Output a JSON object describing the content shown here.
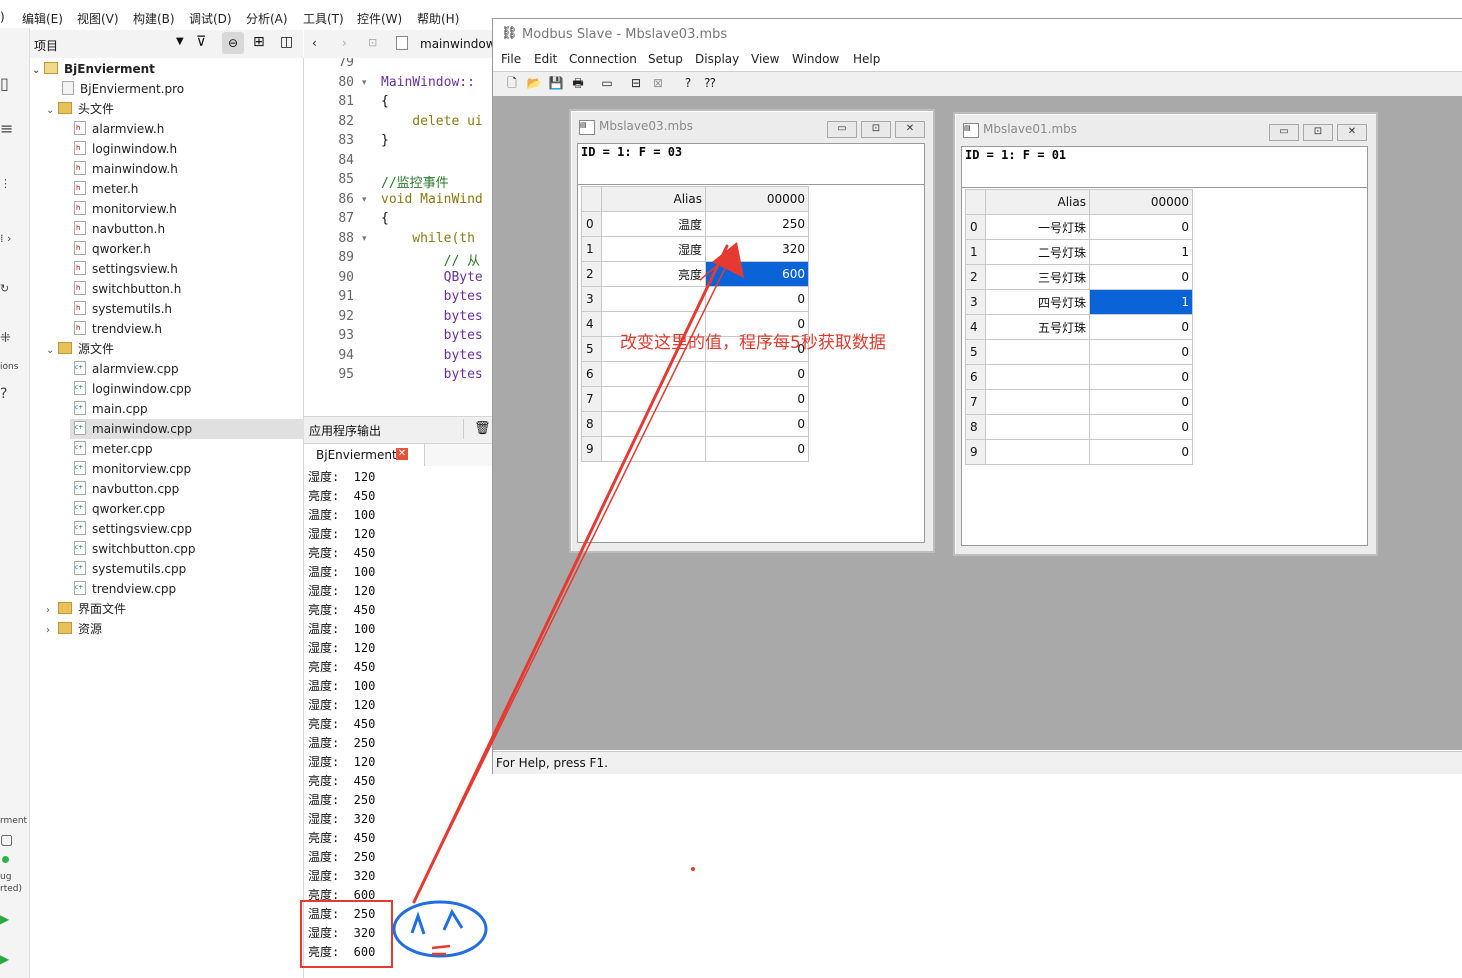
{
  "qt": {
    "menu": [
      "编辑(E)",
      "视图(V)",
      "构建(B)",
      "调试(D)",
      "分析(A)",
      "工具(T)",
      "控件(W)",
      "帮助(H)"
    ],
    "menu_prefix": ")",
    "project_panel_title": "项目",
    "mode_labels": [
      "ions",
      "rment",
      "ug",
      "rted)"
    ],
    "tree": {
      "project": "BjEnvierment",
      "pro_file": "BjEnvierment.pro",
      "headers_label": "头文件",
      "headers": [
        "alarmview.h",
        "loginwindow.h",
        "mainwindow.h",
        "meter.h",
        "monitorview.h",
        "navbutton.h",
        "qworker.h",
        "settingsview.h",
        "switchbutton.h",
        "systemutils.h",
        "trendview.h"
      ],
      "sources_label": "源文件",
      "sources": [
        "alarmview.cpp",
        "loginwindow.cpp",
        "main.cpp",
        "mainwindow.cpp",
        "meter.cpp",
        "monitorview.cpp",
        "navbutton.cpp",
        "qworker.cpp",
        "settingsview.cpp",
        "switchbutton.cpp",
        "systemutils.cpp",
        "trendview.cpp"
      ],
      "selected_source": "mainwindow.cpp",
      "forms_label": "界面文件",
      "resources_label": "资源"
    },
    "editor": {
      "tab_label": "mainwindow",
      "line_numbers": [
        "79",
        "80",
        "81",
        "82",
        "83",
        "84",
        "85",
        "86",
        "87",
        "88",
        "89",
        "90",
        "91",
        "92",
        "93",
        "94",
        "95"
      ],
      "lines": [
        "",
        "MainWindow::",
        "{",
        "    delete ui",
        "}",
        "",
        "//监控事件",
        "void MainWind",
        "{",
        "    while(th",
        "        // 从",
        "        QByte",
        "        bytes",
        "        bytes",
        "        bytes",
        "        bytes",
        "        bytes"
      ]
    },
    "output": {
      "header": "应用程序输出",
      "tab": "BjEnvierment",
      "lines": [
        "湿度:  120",
        "亮度:  450",
        "温度:  100",
        "湿度:  120",
        "亮度:  450",
        "温度:  100",
        "湿度:  120",
        "亮度:  450",
        "温度:  100",
        "湿度:  120",
        "亮度:  450",
        "温度:  100",
        "湿度:  120",
        "亮度:  450",
        "温度:  250",
        "湿度:  120",
        "亮度:  450",
        "温度:  250",
        "湿度:  320",
        "亮度:  450",
        "温度:  250",
        "湿度:  320",
        "亮度:  600",
        "温度:  250",
        "湿度:  320",
        "亮度:  600"
      ]
    }
  },
  "modbus": {
    "title": "Modbus Slave - Mbslave03.mbs",
    "menu": [
      "File",
      "Edit",
      "Connection",
      "Setup",
      "Display",
      "View",
      "Window",
      "Help"
    ],
    "status": "For Help, press F1.",
    "child1": {
      "title": "Mbslave03.mbs",
      "info": "ID = 1: F = 03",
      "col_alias": "Alias",
      "col_addr": "00000",
      "rows": [
        {
          "idx": "0",
          "alias": "温度",
          "value": "250"
        },
        {
          "idx": "1",
          "alias": "湿度",
          "value": "320"
        },
        {
          "idx": "2",
          "alias": "亮度",
          "value": "600"
        },
        {
          "idx": "3",
          "alias": "",
          "value": "0"
        },
        {
          "idx": "4",
          "alias": "",
          "value": "0"
        },
        {
          "idx": "5",
          "alias": "",
          "value": "0"
        },
        {
          "idx": "6",
          "alias": "",
          "value": "0"
        },
        {
          "idx": "7",
          "alias": "",
          "value": "0"
        },
        {
          "idx": "8",
          "alias": "",
          "value": "0"
        },
        {
          "idx": "9",
          "alias": "",
          "value": "0"
        }
      ],
      "selected_row": 2
    },
    "child2": {
      "title": "Mbslave01.mbs",
      "info": "ID = 1: F = 01",
      "col_alias": "Alias",
      "col_addr": "00000",
      "rows": [
        {
          "idx": "0",
          "alias": "一号灯珠",
          "value": "0"
        },
        {
          "idx": "1",
          "alias": "二号灯珠",
          "value": "1"
        },
        {
          "idx": "2",
          "alias": "三号灯珠",
          "value": "0"
        },
        {
          "idx": "3",
          "alias": "四号灯珠",
          "value": "1"
        },
        {
          "idx": "4",
          "alias": "五号灯珠",
          "value": "0"
        },
        {
          "idx": "5",
          "alias": "",
          "value": "0"
        },
        {
          "idx": "6",
          "alias": "",
          "value": "0"
        },
        {
          "idx": "7",
          "alias": "",
          "value": "0"
        },
        {
          "idx": "8",
          "alias": "",
          "value": "0"
        },
        {
          "idx": "9",
          "alias": "",
          "value": "0"
        }
      ],
      "selected_row": 3
    }
  },
  "annotation": {
    "note": "改变这里的值，程序每5秒获取数据",
    "color": "#e03a2e",
    "doodle_color": "#1f6fe0"
  }
}
